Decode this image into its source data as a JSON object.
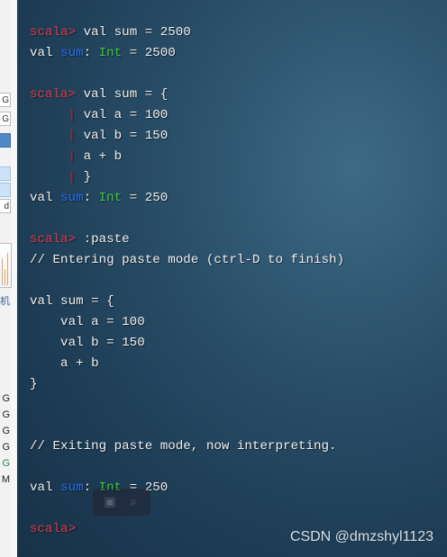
{
  "left_strip": {
    "cells": [
      "G",
      "G",
      "",
      "",
      "",
      "d"
    ],
    "chinese_text": "机",
    "letters": [
      "G",
      "G",
      "G",
      "G",
      "G",
      "M"
    ]
  },
  "terminal": {
    "lines": [
      {
        "segments": [
          {
            "t": "scala> ",
            "c": "prompt"
          },
          {
            "t": "val sum = 2500",
            "c": ""
          }
        ]
      },
      {
        "segments": [
          {
            "t": "val ",
            "c": ""
          },
          {
            "t": "sum",
            "c": "name-blue"
          },
          {
            "t": ": ",
            "c": ""
          },
          {
            "t": "Int",
            "c": "type-green"
          },
          {
            "t": " = 2500",
            "c": ""
          }
        ]
      },
      {
        "segments": []
      },
      {
        "segments": [
          {
            "t": "scala> ",
            "c": "prompt"
          },
          {
            "t": "val sum = {",
            "c": ""
          }
        ]
      },
      {
        "segments": [
          {
            "t": "     ",
            "c": ""
          },
          {
            "t": "| ",
            "c": "pipe"
          },
          {
            "t": "val a = 100",
            "c": ""
          }
        ]
      },
      {
        "segments": [
          {
            "t": "     ",
            "c": ""
          },
          {
            "t": "| ",
            "c": "pipe"
          },
          {
            "t": "val b = 150",
            "c": ""
          }
        ]
      },
      {
        "segments": [
          {
            "t": "     ",
            "c": ""
          },
          {
            "t": "| ",
            "c": "pipe"
          },
          {
            "t": "a + b",
            "c": ""
          }
        ]
      },
      {
        "segments": [
          {
            "t": "     ",
            "c": ""
          },
          {
            "t": "| ",
            "c": "pipe"
          },
          {
            "t": "}",
            "c": ""
          }
        ]
      },
      {
        "segments": [
          {
            "t": "val ",
            "c": ""
          },
          {
            "t": "sum",
            "c": "name-blue"
          },
          {
            "t": ": ",
            "c": ""
          },
          {
            "t": "Int",
            "c": "type-green"
          },
          {
            "t": " = 250",
            "c": ""
          }
        ]
      },
      {
        "segments": []
      },
      {
        "segments": [
          {
            "t": "scala> ",
            "c": "prompt"
          },
          {
            "t": ":paste",
            "c": ""
          }
        ]
      },
      {
        "segments": [
          {
            "t": "// Entering paste mode (ctrl-D to finish)",
            "c": ""
          }
        ]
      },
      {
        "segments": []
      },
      {
        "segments": [
          {
            "t": "val sum = {",
            "c": ""
          }
        ]
      },
      {
        "segments": [
          {
            "t": "    val a = 100",
            "c": ""
          }
        ]
      },
      {
        "segments": [
          {
            "t": "    val b = 150",
            "c": ""
          }
        ]
      },
      {
        "segments": [
          {
            "t": "    a + b",
            "c": ""
          }
        ]
      },
      {
        "segments": [
          {
            "t": "}",
            "c": ""
          }
        ]
      },
      {
        "segments": []
      },
      {
        "segments": []
      },
      {
        "segments": [
          {
            "t": "// Exiting paste mode, now interpreting.",
            "c": ""
          }
        ]
      },
      {
        "segments": []
      },
      {
        "segments": [
          {
            "t": "val ",
            "c": ""
          },
          {
            "t": "sum",
            "c": "name-blue"
          },
          {
            "t": ": ",
            "c": ""
          },
          {
            "t": "Int",
            "c": "type-green"
          },
          {
            "t": " = 250",
            "c": ""
          }
        ]
      },
      {
        "segments": []
      },
      {
        "segments": [
          {
            "t": "scala> ",
            "c": "prompt"
          }
        ]
      }
    ]
  },
  "watermark": "CSDN @dmzshyl1123",
  "colors": {
    "prompt": "#e03a4a",
    "identifier": "#2c6ff0",
    "type": "#3ccb3c",
    "continuation_pipe": "#c21f3a",
    "text": "#f0f0f0"
  }
}
